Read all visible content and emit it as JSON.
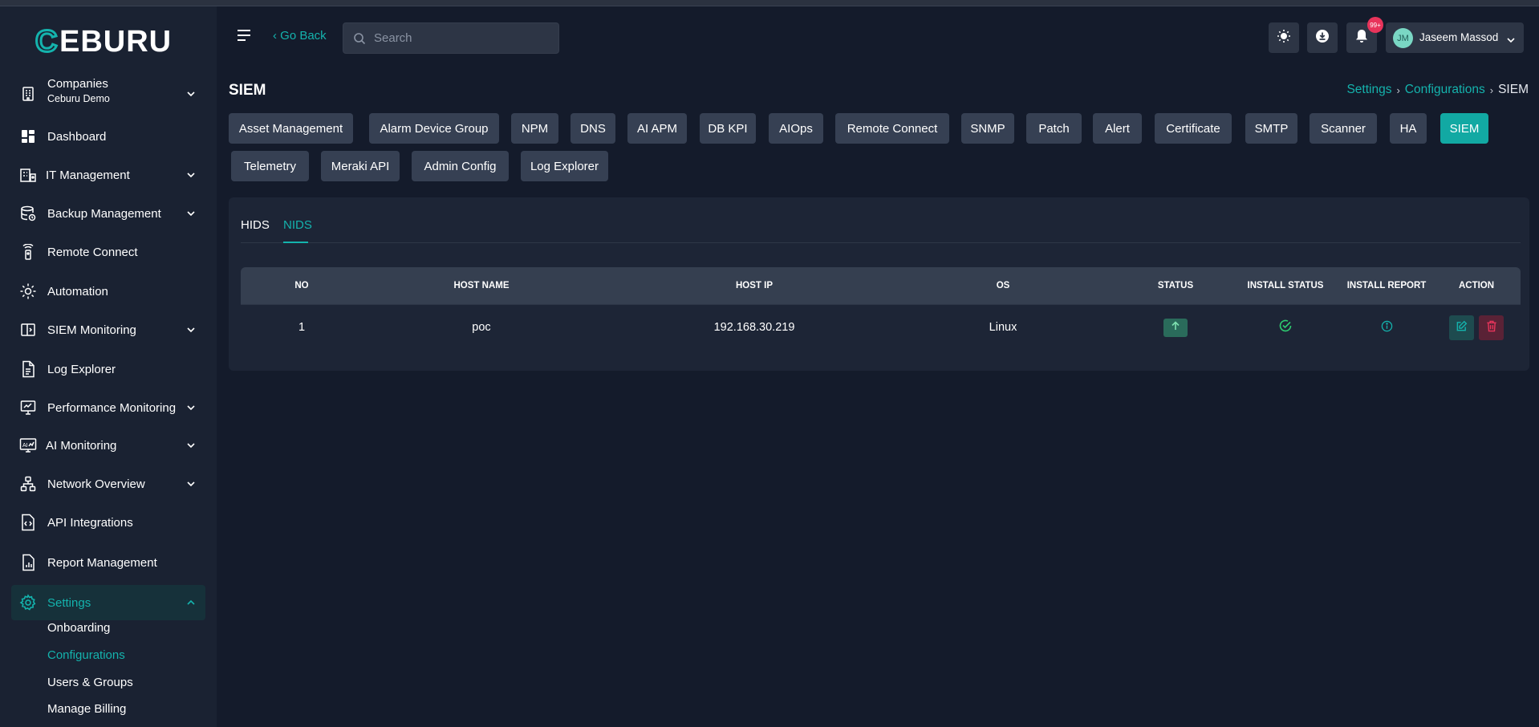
{
  "brand": {
    "logo_text": "CEBURU"
  },
  "header": {
    "go_back": "‹ Go Back",
    "search_placeholder": "Search",
    "notification_badge": "99+",
    "user_initials": "JM",
    "user_name": "Jaseem Massod"
  },
  "sidebar": {
    "company_label": "Companies",
    "company_name": "Ceburu Demo",
    "items": [
      {
        "label": "Dashboard"
      },
      {
        "label": "IT Management"
      },
      {
        "label": "Backup Management"
      },
      {
        "label": "Remote Connect"
      },
      {
        "label": "Automation"
      },
      {
        "label": "SIEM Monitoring"
      },
      {
        "label": "Log Explorer"
      },
      {
        "label": "Performance Monitoring"
      },
      {
        "label": "AI Monitoring"
      },
      {
        "label": "Network Overview"
      },
      {
        "label": "API Integrations"
      },
      {
        "label": "Report Management"
      },
      {
        "label": "Settings"
      }
    ],
    "settings_sub": [
      {
        "label": "Onboarding"
      },
      {
        "label": "Configurations"
      },
      {
        "label": "Users & Groups"
      },
      {
        "label": "Manage Billing"
      }
    ]
  },
  "page": {
    "title": "SIEM",
    "breadcrumb": [
      "Settings",
      "Configurations",
      "SIEM"
    ]
  },
  "config_tabs": [
    "Asset Management",
    "Alarm Device Group",
    "NPM",
    "DNS",
    "AI APM",
    "DB KPI",
    "AIOps",
    "Remote Connect",
    "SNMP",
    "Patch",
    "Alert",
    "Certificate",
    "SMTP",
    "Scanner",
    "HA",
    "SIEM",
    "Telemetry",
    "Meraki API",
    "Admin Config",
    "Log Explorer"
  ],
  "active_config_tab": "SIEM",
  "sub_tabs": [
    "HIDS",
    "NIDS"
  ],
  "active_sub_tab": "NIDS",
  "table": {
    "columns": [
      "NO",
      "HOST NAME",
      "HOST IP",
      "OS",
      "STATUS",
      "INSTALL STATUS",
      "INSTALL REPORT",
      "ACTION"
    ],
    "rows": [
      {
        "no": "1",
        "host_name": "poc",
        "host_ip": "192.168.30.219",
        "os": "Linux",
        "status": "up",
        "install_status": "success"
      }
    ]
  },
  "colors": {
    "accent": "#14b3ad",
    "background": "#141b2b",
    "sidebar": "#1a2232",
    "card": "#1d2536",
    "danger": "#e8345b",
    "success": "#2ecc71"
  }
}
